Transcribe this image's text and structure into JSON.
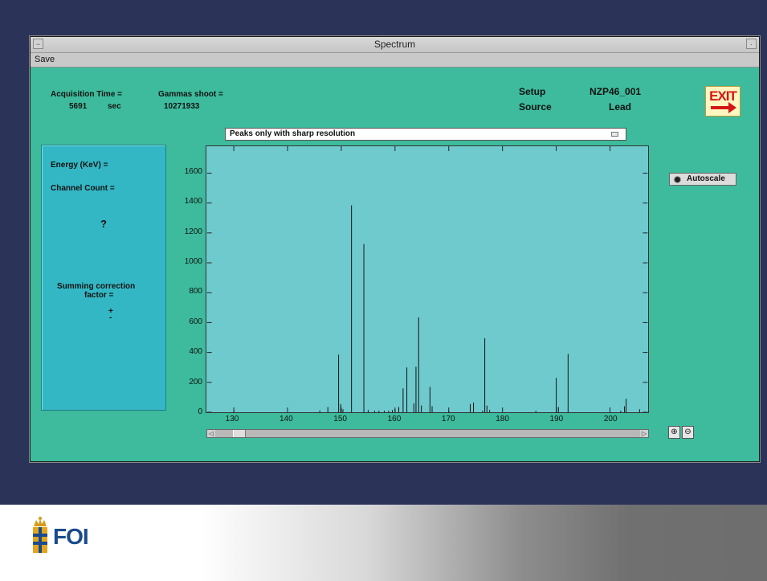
{
  "window": {
    "title": "Spectrum",
    "minimize_glyph": "−",
    "close_glyph": "·"
  },
  "menu": {
    "save_label": "Save"
  },
  "acquisition": {
    "time_label": "Acquisition Time =",
    "time_value": "5691",
    "time_unit": "sec",
    "gammas_label": "Gammas shoot =",
    "gammas_value": "10271933"
  },
  "setup": {
    "setup_label": "Setup",
    "setup_value": "NZP46_001",
    "source_label": "Source",
    "source_value": "Lead"
  },
  "exit_button": {
    "label": "EXIT",
    "icon": "exit-arrow-icon",
    "color": "#d41616"
  },
  "filter_dropdown": {
    "selected": "Peaks only with sharp resolution"
  },
  "info_panel": {
    "energy_label": "Energy (KeV) =",
    "channel_label": "Channel Count =",
    "question": "?",
    "summing_label_1": "Summing correction",
    "summing_label_2": "factor =",
    "plus": "+",
    "minus": "-"
  },
  "autoscale": {
    "label": "Autoscale",
    "enabled": true
  },
  "zoom": {
    "zoom_in_icon": "zoom-in-icon",
    "zoom_out_icon": "zoom-out-icon"
  },
  "brand": {
    "name": "FOI"
  },
  "colors": {
    "background": "#2b3358",
    "window": "#3dbb9c",
    "plot": "#6fcacd",
    "panel": "#34b7c4"
  },
  "chart_data": {
    "type": "bar",
    "title": "",
    "xlabel": "",
    "ylabel": "",
    "xlim": [
      125,
      207
    ],
    "ylim": [
      0,
      1780
    ],
    "x_ticks": [
      130,
      140,
      150,
      160,
      170,
      180,
      190,
      200
    ],
    "y_ticks": [
      0,
      200,
      400,
      600,
      800,
      1000,
      1200,
      1400,
      1600
    ],
    "peaks": [
      {
        "x": 130.0,
        "y": 10
      },
      {
        "x": 146.0,
        "y": 12
      },
      {
        "x": 147.5,
        "y": 35
      },
      {
        "x": 149.5,
        "y": 385
      },
      {
        "x": 149.9,
        "y": 55
      },
      {
        "x": 150.3,
        "y": 20
      },
      {
        "x": 151.9,
        "y": 1385
      },
      {
        "x": 154.2,
        "y": 1125
      },
      {
        "x": 155.0,
        "y": 15
      },
      {
        "x": 156.2,
        "y": 10
      },
      {
        "x": 157.0,
        "y": 10
      },
      {
        "x": 158.0,
        "y": 10
      },
      {
        "x": 158.8,
        "y": 10
      },
      {
        "x": 159.5,
        "y": 15
      },
      {
        "x": 160.0,
        "y": 20
      },
      {
        "x": 160.7,
        "y": 35
      },
      {
        "x": 161.5,
        "y": 160
      },
      {
        "x": 162.2,
        "y": 300
      },
      {
        "x": 163.5,
        "y": 60
      },
      {
        "x": 163.9,
        "y": 305
      },
      {
        "x": 164.4,
        "y": 635
      },
      {
        "x": 164.9,
        "y": 45
      },
      {
        "x": 166.5,
        "y": 170
      },
      {
        "x": 166.9,
        "y": 40
      },
      {
        "x": 170.0,
        "y": 10
      },
      {
        "x": 174.0,
        "y": 55
      },
      {
        "x": 174.6,
        "y": 65
      },
      {
        "x": 176.3,
        "y": 10
      },
      {
        "x": 176.7,
        "y": 495
      },
      {
        "x": 177.1,
        "y": 45
      },
      {
        "x": 177.6,
        "y": 15
      },
      {
        "x": 186.2,
        "y": 10
      },
      {
        "x": 190.0,
        "y": 230
      },
      {
        "x": 190.4,
        "y": 35
      },
      {
        "x": 192.2,
        "y": 390
      },
      {
        "x": 202.0,
        "y": 10
      },
      {
        "x": 202.7,
        "y": 40
      },
      {
        "x": 203.0,
        "y": 90
      },
      {
        "x": 205.5,
        "y": 20
      }
    ]
  }
}
